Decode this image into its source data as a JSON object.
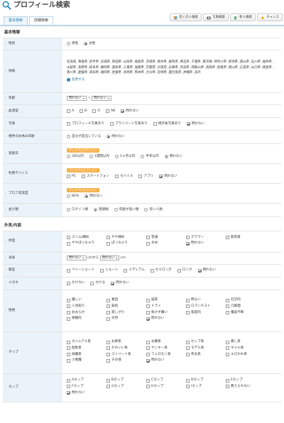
{
  "header": {
    "title": "プロフィール検索",
    "icon": "magnifier-icon"
  },
  "tabs": [
    {
      "label": "基本検索"
    },
    {
      "label": "詳細検索"
    }
  ],
  "tools": [
    {
      "label": "近くの人検索",
      "icon": "people-icon"
    },
    {
      "label": "写真検索",
      "icon": "camera-icon"
    },
    {
      "label": "新人検索",
      "icon": "person-plus-icon"
    },
    {
      "label": "チャンス",
      "icon": "star-icon"
    }
  ],
  "basic": {
    "title": "基本情報",
    "gender": {
      "label": "性別",
      "options": [
        "男性",
        "女性"
      ],
      "selected": "女性"
    },
    "region": {
      "label": "地域",
      "text": "北海道 ,青森県 ,岩手県 ,宮城県 ,秋田県 ,山形県 ,福島県 ,茨城県 ,栃木県 ,群馬県 ,埼玉県 ,千葉県 ,東京都 ,神奈川県 ,新潟県 ,富山県 ,石川県 ,福井県 ,山梨県 ,長野県 ,岐阜県 ,静岡県 ,愛知県 ,三重県 ,滋賀県 ,京都府 ,大阪府 ,兵庫県 ,奈良県 ,和歌山県 ,鳥取県 ,島根県 ,岡山県 ,広島県 ,山口県 ,徳島県 ,香川県 ,愛媛県 ,高知県 ,福岡県 ,佐賀県 ,長崎県 ,熊本県 ,大分県 ,宮崎県 ,鹿児島県 ,沖縄県 ,海外",
      "change": "変更する"
    },
    "age": {
      "label": "年齢",
      "from": "問わない",
      "sep": "〜",
      "to": "問わない"
    },
    "blood": {
      "label": "血液型",
      "options": [
        "A",
        "B",
        "O",
        "AB",
        "問わない"
      ],
      "checked": "問わない"
    },
    "photo": {
      "label": "写真",
      "options": [
        "プロフィール写真あり",
        "プライベート写真あり",
        "掲示板写真あり",
        "問わない"
      ],
      "checked": "問わない"
    },
    "invite": {
      "label": "相手のお休み年齢",
      "options": [
        "自分が該当している",
        "問わない"
      ],
      "selected": "問わない"
    },
    "login": {
      "label": "登録日",
      "premium": "プレミアムオプション",
      "options": [
        "3日以内",
        "1週間以内",
        "1ヶ月以内",
        "半年以内",
        "問わない"
      ],
      "selected": "問わない"
    },
    "device": {
      "label": "利用デバイス",
      "premium": "プレミアムオプション",
      "options": [
        "PC",
        "スマートフォン",
        "モバイル",
        "アプリ",
        "問わない"
      ],
      "checked": "問わない"
    },
    "fill": {
      "label": "プロフ充実度",
      "premium": "プレミアムオプション",
      "options": [
        "80%",
        "問わない"
      ],
      "selected": "問わない"
    },
    "order": {
      "label": "並び順",
      "options": [
        "ログイン順",
        "登録順",
        "年齢が低い順",
        "近い人順"
      ],
      "selected": "登録順"
    }
  },
  "look": {
    "title": "外見/内面",
    "body": {
      "label": "体型",
      "options": [
        "スリム/細め",
        "やや細め",
        "普通",
        "グラマー",
        "筋肉質",
        "ややぽっちゃり",
        "ぽっちゃり",
        "太め",
        "問わない"
      ],
      "checked": "問わない"
    },
    "height": {
      "label": "身長",
      "from": "問わない",
      "mid": "cmから",
      "to": "問わない",
      "unit": "cm"
    },
    "hair": {
      "label": "髪型",
      "options": [
        "ベリーショート",
        "ショート",
        "ミディアム",
        "セミロング",
        "ロング",
        "問わない"
      ],
      "checked": "問わない"
    },
    "glasses": {
      "label": "メガネ",
      "options": [
        "かけない",
        "かける",
        "問わない"
      ],
      "checked": "問わない"
    },
    "personality": {
      "label": "性格",
      "options": [
        "優しい",
        "素直",
        "誠実",
        "明るい",
        "社交的",
        "人見知り",
        "知的",
        "ドライ",
        "ロマンチスト",
        "几帳面",
        "おおらか",
        "寂しがり",
        "負けず嫌い",
        "家庭的",
        "優柔不断",
        "楽観的",
        "天然",
        "問わない"
      ],
      "checked": "問わない"
    },
    "type": {
      "label": "タイプ",
      "options": [
        "カジュアル系",
        "お姉系",
        "お嬢系",
        "セレブ系",
        "癒し系",
        "個性系",
        "かわいい系",
        "ヤンキー系",
        "モデル系",
        "ギャル系",
        "綺麗系",
        "ストリート系",
        "フェロモン系",
        "色気系",
        "エロかわ系",
        "小悪魔",
        "その他",
        "問わない"
      ],
      "checked": "問わない"
    },
    "cup": {
      "label": "カップ",
      "options": [
        "Aカップ",
        "Bカップ",
        "Cカップ",
        "Dカップ",
        "Eカップ",
        "Fカップ",
        "Gカップ",
        "Hカップ",
        "Iカップ",
        "教えられない",
        "問わない"
      ],
      "checked": "問わない"
    }
  }
}
